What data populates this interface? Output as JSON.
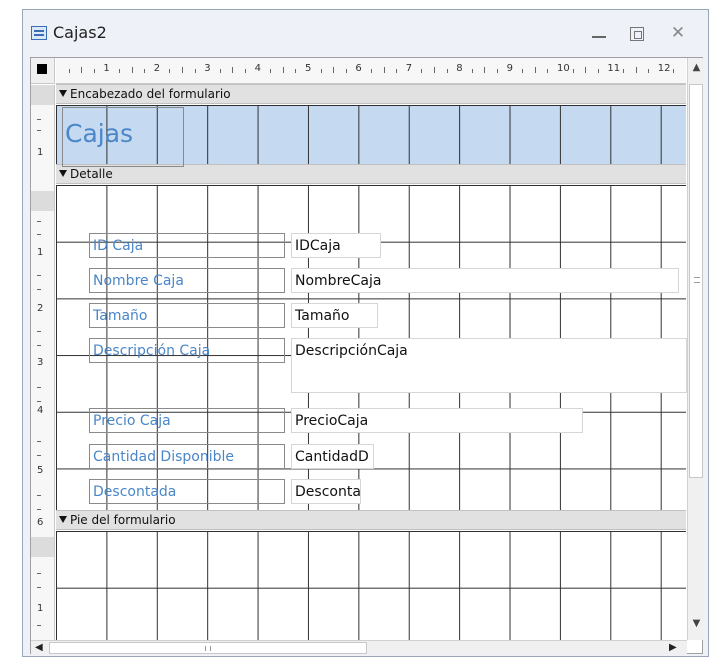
{
  "window": {
    "title": "Cajas2"
  },
  "sections": {
    "header": "Encabezado del formulario",
    "detail": "Detalle",
    "footer": "Pie del formulario"
  },
  "header_label": "Cajas",
  "ruler": {
    "horizontal": [
      "1",
      "2",
      "3",
      "4",
      "5",
      "6",
      "7",
      "8",
      "9",
      "10",
      "11",
      "12"
    ],
    "vertical": [
      "1",
      "1",
      "2",
      "3",
      "4",
      "5",
      "6",
      "1"
    ]
  },
  "detail_controls": [
    {
      "label": "ID Caja",
      "field": "IDCaja"
    },
    {
      "label": "Nombre Caja",
      "field": "NombreCaja"
    },
    {
      "label": "Tamaño",
      "field": "Tamaño"
    },
    {
      "label": "Descripción Caja",
      "field": "DescripciónCaja"
    },
    {
      "label": "Precio Caja",
      "field": "PrecioCaja"
    },
    {
      "label": "Cantidad Disponible",
      "field": "CantidadD"
    },
    {
      "label": "Descontada",
      "field": "Desconta"
    }
  ],
  "colors": {
    "header_band": "#c5d9f1",
    "label_text": "#4a86c8",
    "grid_line": "#303030"
  },
  "icons": {
    "app": "form-icon",
    "minimize": "minimize-icon",
    "maximize": "maximize-icon",
    "close": "close-icon"
  }
}
